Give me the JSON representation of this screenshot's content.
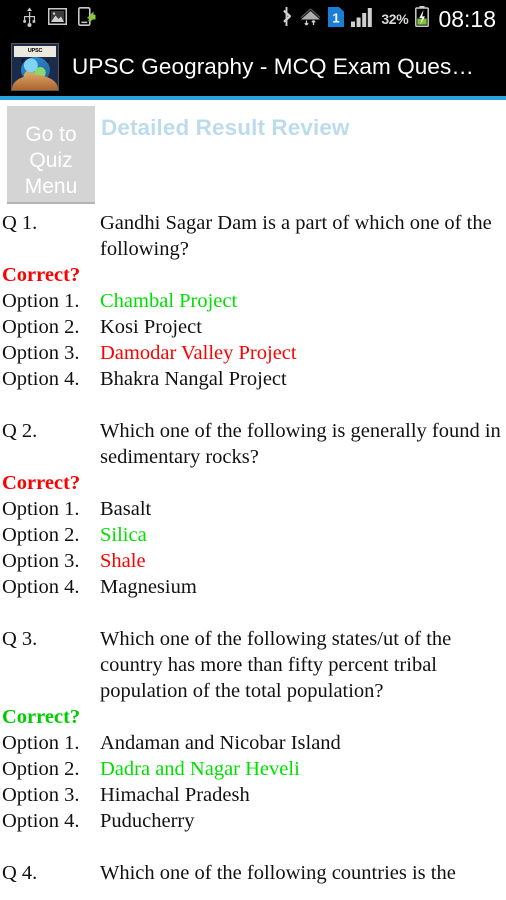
{
  "status_bar": {
    "left_icons": [
      "usb-icon",
      "screenshot-image-icon",
      "file-transfer-icon"
    ],
    "right_icons": [
      "bluetooth-icon",
      "wifi-icon",
      "sim-one-icon",
      "signal-bars-icon",
      "battery-charging-icon"
    ],
    "sim_label": "1",
    "battery_percent": "32%",
    "clock": "08:18"
  },
  "title_bar": {
    "app_icon_label": "UPSC Geography",
    "title": "UPSC Geography - MCQ Exam Ques…"
  },
  "header": {
    "quiz_menu_button": "Go to Quiz Menu",
    "page_heading": "Detailed Result Review",
    "accent_color": "#29a3dd",
    "heading_color": "#bcdcec"
  },
  "legend_colors": {
    "correct_answer": "#00e000",
    "wrong_selection": "#ff0000",
    "plain": "#111111"
  },
  "review": {
    "correct_label": "Correct?",
    "questions": [
      {
        "number": "Q 1.",
        "text": "Gandhi Sagar Dam is a part of which one of the following?",
        "verdict": "Correct?",
        "verdict_state": "wrong",
        "options": [
          {
            "label": "Option 1.",
            "text": "Chambal Project",
            "state": "correct"
          },
          {
            "label": "Option 2.",
            "text": "Kosi Project",
            "state": "plain"
          },
          {
            "label": "Option 3.",
            "text": "Damodar Valley Project",
            "state": "wrong"
          },
          {
            "label": "Option 4.",
            "text": "Bhakra Nangal Project",
            "state": "plain"
          }
        ]
      },
      {
        "number": "Q 2.",
        "text": "Which one of the following is generally found in sedimentary rocks?",
        "verdict": "Correct?",
        "verdict_state": "wrong",
        "options": [
          {
            "label": "Option 1.",
            "text": "Basalt",
            "state": "plain"
          },
          {
            "label": "Option 2.",
            "text": "Silica",
            "state": "correct"
          },
          {
            "label": "Option 3.",
            "text": "Shale",
            "state": "wrong"
          },
          {
            "label": "Option 4.",
            "text": "Magnesium",
            "state": "plain"
          }
        ]
      },
      {
        "number": "Q 3.",
        "text": "Which one of the following states/ut of the country has more than fifty percent tribal population of the total population?",
        "verdict": "Correct?",
        "verdict_state": "correct",
        "options": [
          {
            "label": "Option 1.",
            "text": "Andaman and Nicobar Island",
            "state": "plain"
          },
          {
            "label": "Option 2.",
            "text": "Dadra and Nagar Heveli",
            "state": "correct"
          },
          {
            "label": "Option 3.",
            "text": "Himachal Pradesh",
            "state": "plain"
          },
          {
            "label": "Option 4.",
            "text": "Puducherry",
            "state": "plain"
          }
        ]
      },
      {
        "number": "Q 4.",
        "text": "Which one of the following countries is the",
        "verdict": "",
        "verdict_state": "",
        "options": []
      }
    ]
  }
}
